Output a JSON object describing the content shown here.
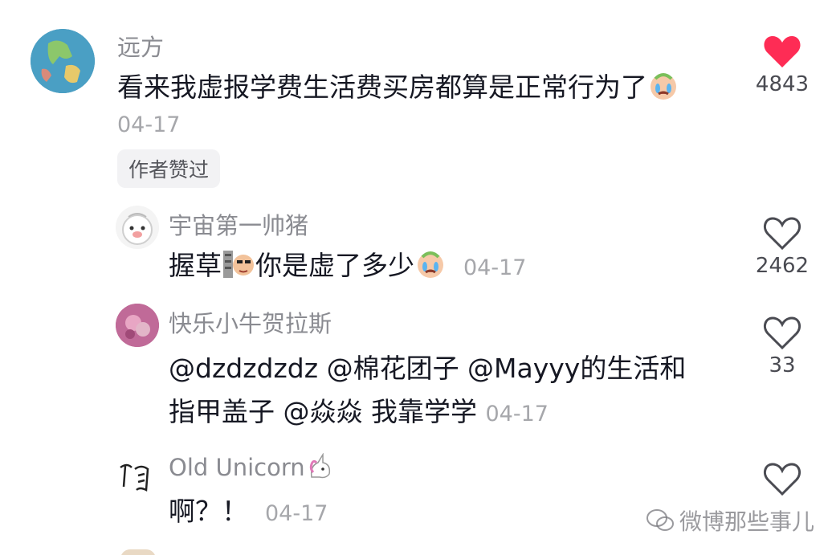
{
  "comments": [
    {
      "user": "远方",
      "text": "看来我虚报学费生活费买房都算是正常行为了",
      "date": "04-17",
      "badge": "作者赞过",
      "likes": "4843",
      "liked": true
    },
    {
      "user": "宇宙第一帅猪",
      "text_a": "握草",
      "text_b": "你是虚了多少",
      "date": "04-17",
      "likes": "2462",
      "liked": false
    },
    {
      "user": "快乐小牛贺拉斯",
      "line1": "@dzdzdzdz @棉花团子 @Mayyy的生活和",
      "line2": "指甲盖子 @焱焱 我靠学学",
      "date": "04-17",
      "likes": "33",
      "liked": false
    },
    {
      "user": "Old Unicorn",
      "text": "啊？！",
      "date": "04-17",
      "likes": "",
      "liked": false
    }
  ],
  "watermark": "微博那些事儿",
  "colors": {
    "like_red": "#fe2c55",
    "name_gray": "#8a8b91",
    "date_gray": "#a6a7ab"
  }
}
